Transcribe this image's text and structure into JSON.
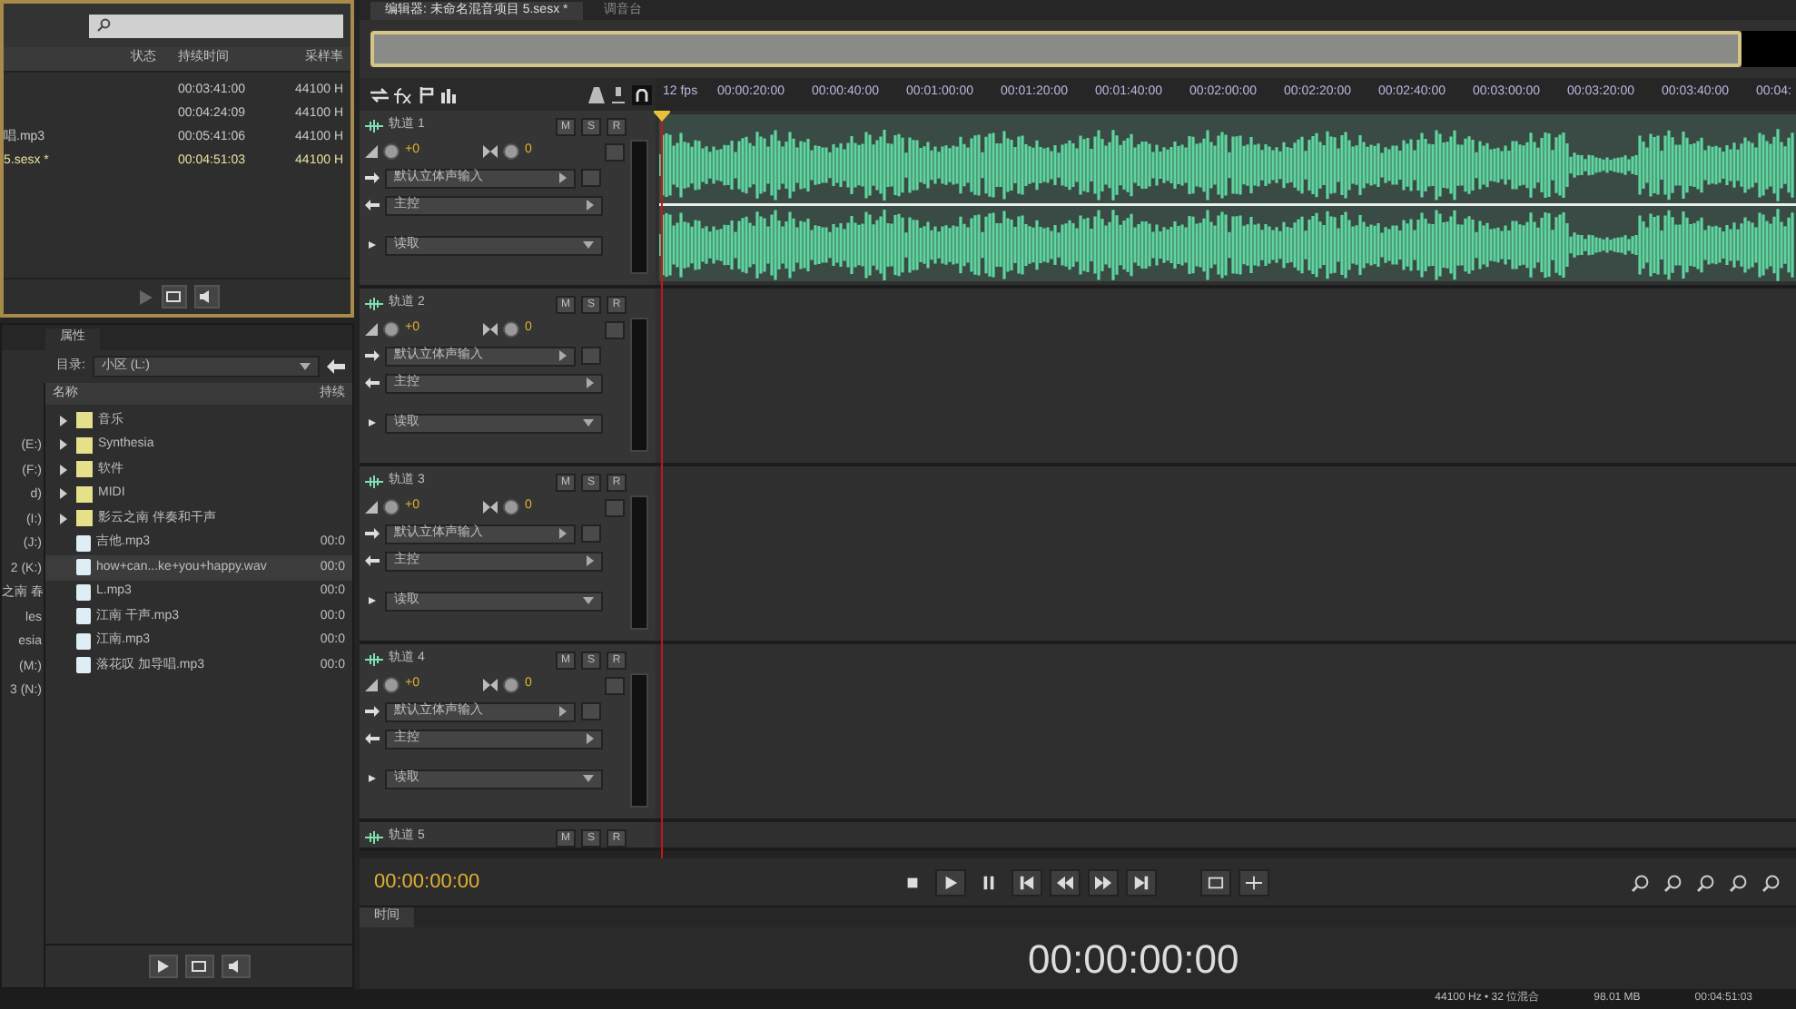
{
  "files_panel": {
    "columns": [
      "状态",
      "持续时间",
      "采样率"
    ],
    "rows": [
      {
        "name": "",
        "duration": "00:03:41:00",
        "rate": "44100 H",
        "selected": false
      },
      {
        "name": "",
        "duration": "00:04:24:09",
        "rate": "44100 H",
        "selected": false
      },
      {
        "name": "唱.mp3",
        "duration": "00:05:41:06",
        "rate": "44100 H",
        "selected": false
      },
      {
        "name": "5.sesx *",
        "duration": "00:04:51:03",
        "rate": "44100 H",
        "selected": true
      }
    ]
  },
  "browser_panel": {
    "tabs": [
      {
        "label": "属性",
        "selected": false
      }
    ],
    "directory_label": "目录:",
    "directory": "小区 (L:)",
    "drives": [
      "(E:)",
      "(F:)",
      "d)",
      "(I:)",
      "(J:)",
      "2 (K:)",
      "之南 春",
      "les",
      "esia",
      "(M:)",
      "3 (N:)"
    ],
    "columns": [
      "名称",
      "持续"
    ],
    "items": [
      {
        "kind": "folder",
        "name": "音乐",
        "selected": false
      },
      {
        "kind": "folder",
        "name": "Synthesia",
        "selected": false
      },
      {
        "kind": "folder",
        "name": "软件",
        "selected": false
      },
      {
        "kind": "folder",
        "name": "MIDI",
        "selected": false
      },
      {
        "kind": "folder",
        "name": "影云之南 伴奏和干声",
        "selected": false
      },
      {
        "kind": "file",
        "name": "吉他.mp3",
        "duration": "00:0",
        "selected": false
      },
      {
        "kind": "file",
        "name": "how+can...ke+you+happy.wav",
        "duration": "00:0",
        "selected": true
      },
      {
        "kind": "file",
        "name": "L.mp3",
        "duration": "00:0",
        "selected": false
      },
      {
        "kind": "file",
        "name": "江南 干声.mp3",
        "duration": "00:0",
        "selected": false
      },
      {
        "kind": "file",
        "name": "江南.mp3",
        "duration": "00:0",
        "selected": false
      },
      {
        "kind": "file",
        "name": "落花叹 加导唱.mp3",
        "duration": "00:0",
        "selected": false
      }
    ]
  },
  "editor": {
    "tabs": [
      {
        "label": "编辑器: 未命名混音项目 5.sesx *",
        "selected": true
      },
      {
        "label": "调音台",
        "selected": false
      }
    ],
    "fps": "12 fps",
    "ruler": [
      "00:00:20:00",
      "00:00:40:00",
      "00:01:00:00",
      "00:01:20:00",
      "00:01:40:00",
      "00:02:00:00",
      "00:02:20:00",
      "00:02:40:00",
      "00:03:00:00",
      "00:03:20:00",
      "00:03:40:00",
      "00:04:"
    ],
    "tracks": [
      {
        "name": "轨道 1",
        "buttons": [
          "M",
          "S",
          "R"
        ],
        "volume": "+0",
        "pan": "0",
        "input": "默认立体声输入",
        "output": "主控",
        "automation": "读取",
        "has_clip": true
      },
      {
        "name": "轨道 2",
        "buttons": [
          "M",
          "S",
          "R"
        ],
        "volume": "+0",
        "pan": "0",
        "input": "默认立体声输入",
        "output": "主控",
        "automation": "读取",
        "has_clip": false
      },
      {
        "name": "轨道 3",
        "buttons": [
          "M",
          "S",
          "R"
        ],
        "volume": "+0",
        "pan": "0",
        "input": "默认立体声输入",
        "output": "主控",
        "automation": "读取",
        "has_clip": false
      },
      {
        "name": "轨道 4",
        "buttons": [
          "M",
          "S",
          "R"
        ],
        "volume": "+0",
        "pan": "0",
        "input": "默认立体声输入",
        "output": "主控",
        "automation": "读取",
        "has_clip": false
      }
    ],
    "partial_track": {
      "name": "轨道 5",
      "buttons": [
        "M",
        "S",
        "R"
      ]
    },
    "current_time": "00:00:00:00"
  },
  "time_panel": {
    "tab": "时间",
    "time": "00:00:00:00"
  },
  "status_bar": [
    "44100 Hz • 32 位混合",
    "98.01 MB",
    "00:04:51:03"
  ]
}
